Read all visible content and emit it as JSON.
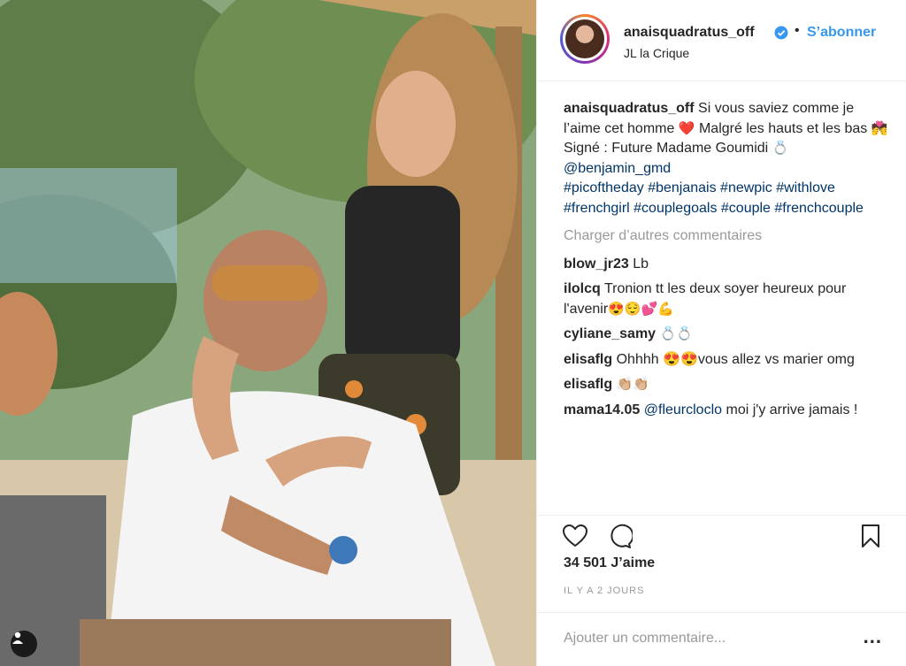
{
  "post": {
    "username": "anaisquadratus_off",
    "follow_label": "S’abonner",
    "dot": "•",
    "location": "JL la Crique",
    "caption_user": "anaisquadratus_off",
    "caption_text_1": "Si vous saviez comme je l’aime cet homme",
    "caption_emoji_1": "❤️",
    "caption_text_2": "Malgré les hauts et les bas",
    "caption_emoji_2": "💏",
    "caption_text_3": "Signé : Future Madame Goumidi",
    "caption_emoji_3": "💍",
    "mention": "@benjamin_gmd",
    "hashtags": [
      "#picoftheday",
      "#benjanais",
      "#newpic",
      "#withlove",
      "#frenchgirl",
      "#couplegoals",
      "#couple",
      "#frenchcouple"
    ],
    "load_more": "Charger d’autres commentaires",
    "comments": [
      {
        "user": "blow_jr23",
        "text": "Lb",
        "emoji": ""
      },
      {
        "user": "ilolcq",
        "text": "Tronion tt les deux soyer heureux pour l'avenir",
        "emoji": "😍😌💕💪"
      },
      {
        "user": "cyliane_samy",
        "text": "",
        "emoji": "💍💍"
      },
      {
        "user": "elisaflg",
        "text": "Ohhhh 😍😍vous allez vs marier omg",
        "emoji": ""
      },
      {
        "user": "elisaflg",
        "text": "",
        "emoji": "👏🏼👏🏼"
      },
      {
        "user": "mama14.05",
        "mention": "@fleurcloclo",
        "text": "moi j'y arrive jamais !",
        "emoji": ""
      }
    ],
    "likes": "34 501 J’aime",
    "time_ago": "IL Y A 2 JOURS",
    "add_comment_placeholder": "Ajouter un commentaire...",
    "more_label": "..."
  },
  "icons": {
    "verified": "verified-badge-icon",
    "like": "heart-icon",
    "comment": "comment-bubble-icon",
    "save": "bookmark-icon",
    "tagged": "user-tag-icon"
  },
  "colors": {
    "link": "#3897f0",
    "hashtag": "#003569",
    "muted": "#999999",
    "text": "#262626"
  }
}
